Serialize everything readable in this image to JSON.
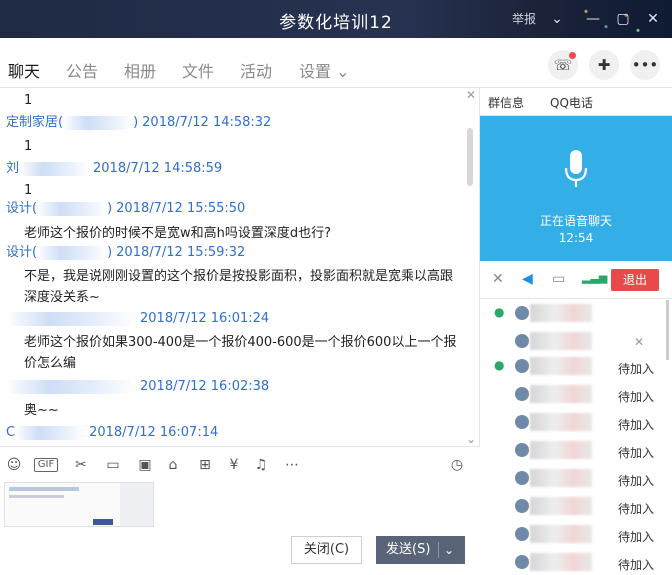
{
  "window": {
    "title": "参数化培训12",
    "report": "举报",
    "controls": [
      "chevron-down-icon",
      "minimize-icon",
      "maximize-icon",
      "close-icon"
    ]
  },
  "tabs": [
    {
      "label": "聊天",
      "active": true
    },
    {
      "label": "公告",
      "active": false
    },
    {
      "label": "相册",
      "active": false
    },
    {
      "label": "文件",
      "active": false
    },
    {
      "label": "活动",
      "active": false
    },
    {
      "label": "设置 ⌄",
      "active": false
    }
  ],
  "messages": [
    {
      "kind": "text",
      "text": "1"
    },
    {
      "kind": "head",
      "name": "定制家居(",
      "suffix": ")",
      "time": "2018/7/12 14:58:32"
    },
    {
      "kind": "text",
      "text": "1"
    },
    {
      "kind": "head",
      "name": "刘",
      "suffix": "",
      "time": "2018/7/12 14:58:59"
    },
    {
      "kind": "text",
      "text": "1"
    },
    {
      "kind": "head",
      "name": "设计(",
      "suffix": ")",
      "time": "2018/7/12 15:55:50"
    },
    {
      "kind": "text",
      "text": "老师这个报价的时候不是宽w和高h吗设置深度d也行?"
    },
    {
      "kind": "head",
      "name": "设计(",
      "suffix": ")",
      "time": "2018/7/12 15:59:32"
    },
    {
      "kind": "text",
      "text": "不是，我是说刚刚设置的这个报价是按投影面积，投影面积就是宽乘以高跟"
    },
    {
      "kind": "text",
      "text": "深度没关系~"
    },
    {
      "kind": "head",
      "name": "",
      "suffix": "",
      "time": "2018/7/12 16:01:24"
    },
    {
      "kind": "text",
      "text": "老师这个报价如果300-400是一个报价400-600是一个报价600以上一个报"
    },
    {
      "kind": "text",
      "text": "价怎么编"
    },
    {
      "kind": "head",
      "name": "",
      "suffix": "",
      "time": "2018/7/12 16:02:38"
    },
    {
      "kind": "text",
      "text": "奥~~"
    },
    {
      "kind": "head",
      "name": "C",
      "suffix": "",
      "time": "2018/7/12 16:07:14"
    }
  ],
  "toolbar": {
    "icons": [
      "emoji-icon",
      "gif-icon",
      "scissors-icon",
      "folder-icon",
      "image-icon",
      "shop-icon",
      "gift-icon",
      "red-packet-icon",
      "bell-icon",
      "more-icon",
      "history-clock-icon"
    ],
    "gif_label": "GIF"
  },
  "buttons": {
    "close_label": "关闭(C)",
    "send_label": "发送(S)"
  },
  "right_panel": {
    "tabs": [
      "群信息",
      "QQ电话"
    ],
    "voice_status": "正在语音聊天",
    "voice_time": "12:54",
    "exit_label": "退出",
    "join_label": "待加入",
    "member_count_joining": 8
  },
  "colors": {
    "accent": "#1aa0f0",
    "voice_bg": "#33aee6",
    "exit": "#e84a4a",
    "send": "#5a6478",
    "meta_text": "#2f6fd0"
  }
}
